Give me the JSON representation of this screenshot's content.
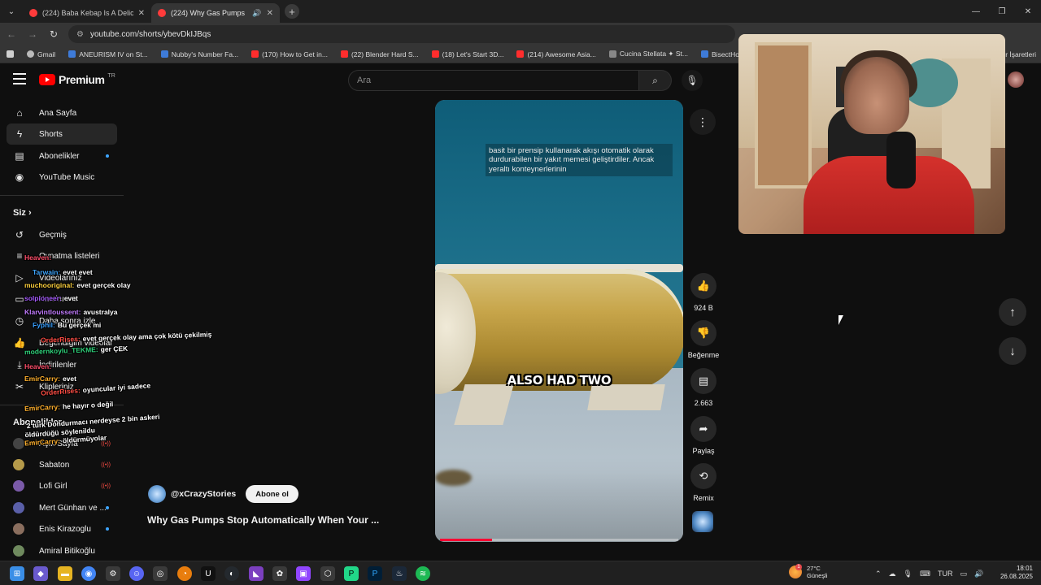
{
  "browser": {
    "tabs": [
      {
        "title": "(224) Baba Kebap Is A Deliciou...",
        "active": false
      },
      {
        "title": "(224) Why Gas Pumps Stop",
        "active": true
      }
    ],
    "url": "youtube.com/shorts/ybevDkIJBqs",
    "bookmarks": [
      "Gmail",
      "ANEURISM IV on St...",
      "Nubby's Number Fa...",
      "(170) How to Get in...",
      "(22) Blender Hard S...",
      "(18) Let's Start 3D...",
      "(214) Awesome Asia...",
      "Cucina Stellata ✦ St...",
      "BisectHosting - Das..."
    ],
    "bookmarks_right": "Yer İşaretleri"
  },
  "youtube": {
    "logo": "Premium",
    "region": "TR",
    "search_placeholder": "Ara",
    "sidebar": {
      "main": [
        {
          "label": "Ana Sayfa",
          "icon": "home-icon"
        },
        {
          "label": "Shorts",
          "icon": "shorts-icon",
          "active": true
        },
        {
          "label": "Abonelikler",
          "icon": "subscriptions-icon"
        },
        {
          "label": "YouTube Music",
          "icon": "youtube-music-icon"
        }
      ],
      "you_header": "Siz",
      "you": [
        {
          "label": "Geçmiş"
        },
        {
          "label": "Oynatma listeleri"
        },
        {
          "label": "Videolarınız"
        },
        {
          "label": "Kurslarınız"
        },
        {
          "label": "Daha sonra izle"
        },
        {
          "label": "Beğendiğim videolar"
        },
        {
          "label": "İndirilenler"
        },
        {
          "label": "Klipleriniz"
        }
      ],
      "subs_header": "Abonelikler",
      "subs": [
        {
          "label": "Açık Sayfa"
        },
        {
          "label": "Sabaton"
        },
        {
          "label": "Lofi Girl"
        },
        {
          "label": "Mert Günhan ve ..."
        },
        {
          "label": "Enis Kirazoglu"
        },
        {
          "label": "Amiral Bitikoğlu"
        }
      ]
    },
    "short": {
      "subtitle": "basit bir prensip kullanarak akışı otomatik olarak durdurabilen bir yakıt memesi geliştirdiler.  Ancak yeraltı konteynerlerinin",
      "caption": "ALSO HAD TWO",
      "progress": 0.22,
      "channel": "@xCrazyStories",
      "subscribe": "Abone ol",
      "title": "Why Gas Pumps Stop Automatically When Your ..."
    },
    "actions": {
      "likes": "924 B",
      "dislike": "Beğenme",
      "comments": "2.663",
      "share": "Paylaş",
      "remix": "Remix"
    }
  },
  "chat": [
    {
      "user": "Heaven:",
      "msg": "",
      "color": "#ff4e6a"
    },
    {
      "user": "Tarwain:",
      "msg": "evet evet",
      "color": "#3ea6ff"
    },
    {
      "user": "muchooriginal:",
      "msg": "evet gerçek olay",
      "color": "#ffd23e"
    },
    {
      "user": "solpioneer:",
      "msg": "evet",
      "color": "#a65bff"
    },
    {
      "user": "Klarvintloussent:",
      "msg": "avustralya",
      "color": "#c27bff"
    },
    {
      "user": "Fyphil:",
      "msg": "Bu gerçek mi",
      "color": "#3aa0ff"
    },
    {
      "user": "OrderRises:",
      "msg": "evet gerçek olay ama çok kötü çekilmiş",
      "color": "#ff4e45"
    },
    {
      "user": "modernkoylu_TEKME:",
      "msg": "ger ÇEK",
      "color": "#2fd17a"
    },
    {
      "user": "Heaven:",
      "msg": "",
      "color": "#ff4e6a"
    },
    {
      "user": "EmirCarry:",
      "msg": "evet",
      "color": "#ffb02e"
    },
    {
      "user": "OrderRises:",
      "msg": "oyuncular iyi sadece",
      "color": "#ff4e45"
    },
    {
      "user": "EmirCarry:",
      "msg": "he hayır o değil",
      "color": "#ffb02e"
    },
    {
      "user": "",
      "msg": "2 türk Dondurmacı nerdeyse 2 bin askeri öldürdüğü söylenildu",
      "color": "#ffffff"
    },
    {
      "user": "EmirCarry:",
      "msg": "öldürmüyolar",
      "color": "#ffb02e"
    }
  ],
  "taskbar": {
    "temp": "27°C",
    "weather": "Güneşli",
    "weather_badge": "1",
    "lang": "TUR",
    "time": "18:01",
    "date": "26.08.2025"
  }
}
